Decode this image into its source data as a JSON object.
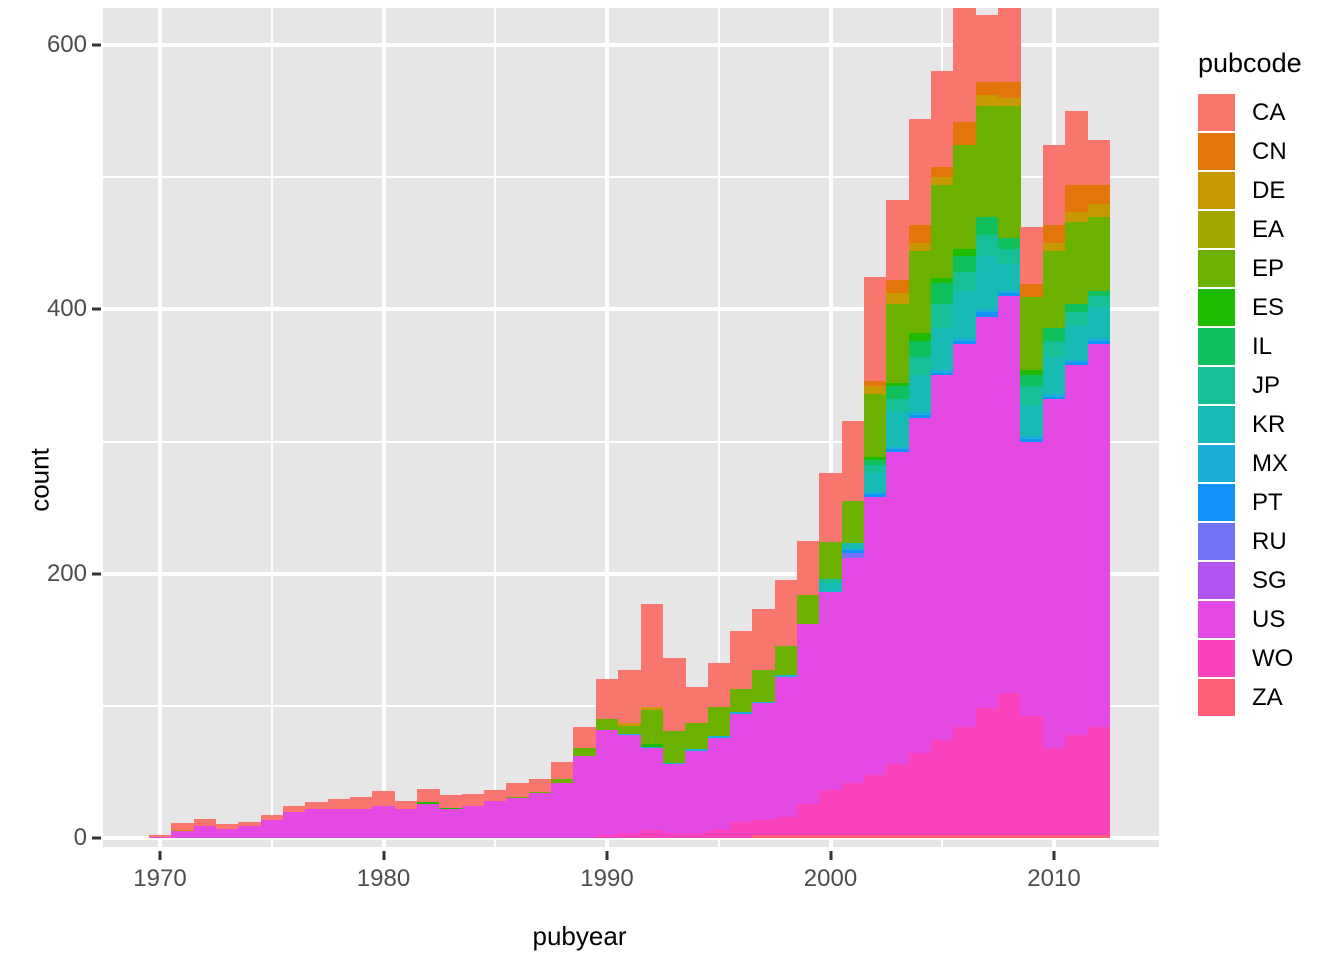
{
  "chart_data": {
    "type": "bar",
    "stacked": true,
    "title": "",
    "xlabel": "pubyear",
    "ylabel": "count",
    "xlim": [
      1968.6,
      1913.0
    ],
    "x_axis": {
      "min": 1968.6,
      "max": 2013.7,
      "ticks": [
        1970,
        1980,
        1990,
        2000,
        2010
      ],
      "minor_ticks": [
        1975,
        1985,
        1995,
        2005
      ]
    },
    "y_axis": {
      "min": 0,
      "max": 627,
      "ticks": [
        0,
        200,
        400,
        600
      ],
      "minor_ticks": [
        100,
        300,
        500
      ]
    },
    "legend": {
      "title": "pubcode",
      "position": "right"
    },
    "grid": true,
    "panel_background": "#e6e6e6",
    "gridline_color": "#ffffff",
    "series": [
      {
        "name": "CA",
        "color": "#f8766d"
      },
      {
        "name": "CN",
        "color": "#e3760b"
      },
      {
        "name": "DE",
        "color": "#c79800"
      },
      {
        "name": "EA",
        "color": "#a3a500"
      },
      {
        "name": "EP",
        "color": "#6bb100"
      },
      {
        "name": "ES",
        "color": "#1ebb00"
      },
      {
        "name": "IL",
        "color": "#10c05c"
      },
      {
        "name": "JP",
        "color": "#16bf96"
      },
      {
        "name": "KR",
        "color": "#17bbb4"
      },
      {
        "name": "MX",
        "color": "#1aadd8"
      },
      {
        "name": "PT",
        "color": "#1291f8"
      },
      {
        "name": "RU",
        "color": "#7274f8"
      },
      {
        "name": "SG",
        "color": "#b254f0"
      },
      {
        "name": "US",
        "color": "#e24ae3"
      },
      {
        "name": "WO",
        "color": "#fa42bc"
      },
      {
        "name": "ZA",
        "color": "#fd5f77"
      }
    ],
    "stack_order_bottom_to_top": [
      "ZA",
      "WO",
      "US",
      "SG",
      "RU",
      "PT",
      "MX",
      "KR",
      "JP",
      "IL",
      "ES",
      "EP",
      "EA",
      "DE",
      "CN",
      "CA"
    ],
    "categories": [
      1970,
      1971,
      1972,
      1973,
      1974,
      1975,
      1976,
      1977,
      1978,
      1979,
      1980,
      1981,
      1982,
      1983,
      1984,
      1985,
      1986,
      1987,
      1988,
      1989,
      1990,
      1991,
      1992,
      1993,
      1994,
      1995,
      1996,
      1997,
      1998,
      1999,
      2000,
      2001,
      2002,
      2003,
      2004,
      2005,
      2006,
      2007,
      2008,
      2009,
      2010,
      2011,
      2012
    ],
    "values": {
      "CA": [
        1,
        5,
        5,
        3,
        3,
        3,
        4,
        5,
        7,
        9,
        11,
        6,
        10,
        9,
        9,
        8,
        10,
        9,
        12,
        16,
        30,
        40,
        78,
        55,
        27,
        33,
        43,
        46,
        50,
        40,
        52,
        60,
        78,
        60,
        80,
        72,
        105,
        50,
        90,
        43,
        60,
        56,
        34
      ],
      "CN": [
        0,
        0,
        0,
        0,
        0,
        0,
        0,
        0,
        0,
        0,
        0,
        0,
        0,
        0,
        0,
        0,
        0,
        0,
        0,
        0,
        0,
        0,
        0,
        0,
        0,
        0,
        0,
        0,
        0,
        0,
        0,
        0,
        4,
        10,
        14,
        8,
        18,
        10,
        12,
        10,
        14,
        20,
        14
      ],
      "DE": [
        0,
        1,
        0,
        0,
        0,
        0,
        0,
        0,
        0,
        0,
        0,
        0,
        0,
        0,
        0,
        0,
        0,
        0,
        0,
        0,
        0,
        2,
        2,
        0,
        0,
        0,
        0,
        0,
        0,
        0,
        0,
        0,
        6,
        8,
        6,
        6,
        0,
        8,
        6,
        0,
        6,
        8,
        10
      ],
      "EA": [
        0,
        0,
        0,
        0,
        0,
        0,
        0,
        0,
        0,
        0,
        0,
        0,
        0,
        0,
        0,
        0,
        0,
        0,
        0,
        0,
        0,
        0,
        0,
        0,
        0,
        0,
        0,
        0,
        0,
        0,
        0,
        0,
        0,
        0,
        0,
        0,
        0,
        0,
        0,
        0,
        0,
        0,
        0
      ],
      "EP": [
        0,
        0,
        0,
        0,
        0,
        0,
        0,
        0,
        0,
        0,
        0,
        0,
        0,
        0,
        0,
        0,
        1,
        1,
        3,
        6,
        8,
        6,
        26,
        24,
        20,
        22,
        18,
        24,
        22,
        22,
        28,
        32,
        48,
        60,
        62,
        70,
        78,
        84,
        100,
        55,
        58,
        62,
        56
      ],
      "ES": [
        0,
        0,
        0,
        0,
        0,
        0,
        0,
        0,
        0,
        0,
        0,
        0,
        1,
        1,
        0,
        0,
        0,
        0,
        0,
        0,
        0,
        0,
        2,
        0,
        0,
        0,
        0,
        0,
        0,
        0,
        0,
        0,
        2,
        2,
        6,
        4,
        6,
        0,
        0,
        4,
        0,
        0,
        0
      ],
      "IL": [
        0,
        0,
        0,
        0,
        0,
        0,
        0,
        0,
        0,
        0,
        0,
        0,
        0,
        0,
        0,
        0,
        0,
        0,
        0,
        0,
        0,
        0,
        0,
        0,
        0,
        0,
        0,
        0,
        0,
        0,
        0,
        0,
        4,
        10,
        12,
        16,
        12,
        14,
        8,
        8,
        10,
        6,
        4
      ],
      "JP": [
        0,
        0,
        0,
        0,
        0,
        0,
        0,
        0,
        0,
        0,
        0,
        0,
        0,
        0,
        0,
        0,
        0,
        0,
        0,
        0,
        0,
        0,
        0,
        0,
        0,
        0,
        0,
        0,
        0,
        0,
        3,
        0,
        6,
        10,
        14,
        18,
        14,
        16,
        12,
        14,
        12,
        10,
        8
      ],
      "KR": [
        0,
        0,
        0,
        0,
        0,
        0,
        0,
        0,
        0,
        0,
        0,
        0,
        0,
        0,
        0,
        0,
        0,
        0,
        0,
        0,
        0,
        0,
        0,
        0,
        0,
        0,
        0,
        0,
        0,
        0,
        6,
        4,
        14,
        26,
        28,
        32,
        36,
        40,
        20,
        24,
        28,
        26,
        24
      ],
      "MX": [
        0,
        0,
        0,
        0,
        0,
        0,
        0,
        0,
        0,
        0,
        0,
        0,
        0,
        0,
        0,
        0,
        0,
        0,
        0,
        0,
        0,
        1,
        1,
        1,
        1,
        1,
        1,
        1,
        1,
        0,
        1,
        1,
        2,
        2,
        2,
        2,
        2,
        2,
        2,
        2,
        2,
        2,
        2
      ],
      "PT": [
        0,
        0,
        0,
        0,
        0,
        0,
        0,
        0,
        0,
        0,
        0,
        0,
        0,
        0,
        0,
        0,
        0,
        0,
        0,
        0,
        0,
        0,
        0,
        0,
        0,
        0,
        0,
        0,
        0,
        0,
        0,
        2,
        2,
        2,
        2,
        2,
        2,
        4,
        2,
        2,
        2,
        2,
        2
      ],
      "RU": [
        0,
        0,
        0,
        0,
        0,
        0,
        0,
        0,
        0,
        0,
        0,
        0,
        0,
        0,
        0,
        0,
        0,
        0,
        0,
        0,
        0,
        0,
        0,
        0,
        0,
        0,
        0,
        0,
        0,
        0,
        0,
        4,
        0,
        0,
        0,
        0,
        0,
        0,
        0,
        0,
        0,
        0,
        0
      ],
      "SG": [
        0,
        0,
        0,
        0,
        0,
        0,
        0,
        0,
        0,
        0,
        0,
        0,
        0,
        0,
        0,
        0,
        0,
        0,
        0,
        0,
        0,
        0,
        0,
        0,
        0,
        0,
        0,
        0,
        0,
        0,
        0,
        0,
        0,
        0,
        0,
        0,
        0,
        0,
        0,
        0,
        0,
        0,
        0
      ],
      "US": [
        1,
        5,
        9,
        7,
        9,
        14,
        20,
        22,
        22,
        22,
        24,
        22,
        26,
        22,
        24,
        28,
        30,
        34,
        42,
        62,
        80,
        74,
        62,
        52,
        62,
        70,
        82,
        88,
        106,
        136,
        150,
        170,
        210,
        236,
        254,
        276,
        290,
        296,
        300,
        208,
        264,
        280,
        290
      ],
      "WO": [
        0,
        0,
        0,
        0,
        0,
        0,
        0,
        0,
        0,
        0,
        0,
        0,
        0,
        0,
        0,
        0,
        0,
        0,
        0,
        0,
        2,
        4,
        6,
        4,
        4,
        6,
        12,
        12,
        14,
        24,
        34,
        40,
        46,
        54,
        62,
        72,
        82,
        96,
        108,
        90,
        66,
        76,
        82
      ],
      "ZA": [
        0,
        0,
        0,
        0,
        0,
        0,
        0,
        0,
        0,
        0,
        0,
        0,
        0,
        0,
        0,
        0,
        0,
        0,
        0,
        0,
        0,
        0,
        0,
        0,
        0,
        0,
        0,
        2,
        2,
        2,
        2,
        2,
        2,
        2,
        2,
        2,
        2,
        2,
        2,
        2,
        2,
        2,
        2
      ]
    },
    "totals": [
      2,
      11,
      14,
      10,
      12,
      17,
      24,
      27,
      29,
      31,
      35,
      28,
      37,
      32,
      33,
      36,
      41,
      44,
      57,
      84,
      120,
      131,
      177,
      136,
      114,
      132,
      156,
      173,
      195,
      224,
      276,
      315,
      424,
      482,
      544,
      580,
      645,
      622,
      662,
      462,
      524,
      550,
      528
    ]
  }
}
